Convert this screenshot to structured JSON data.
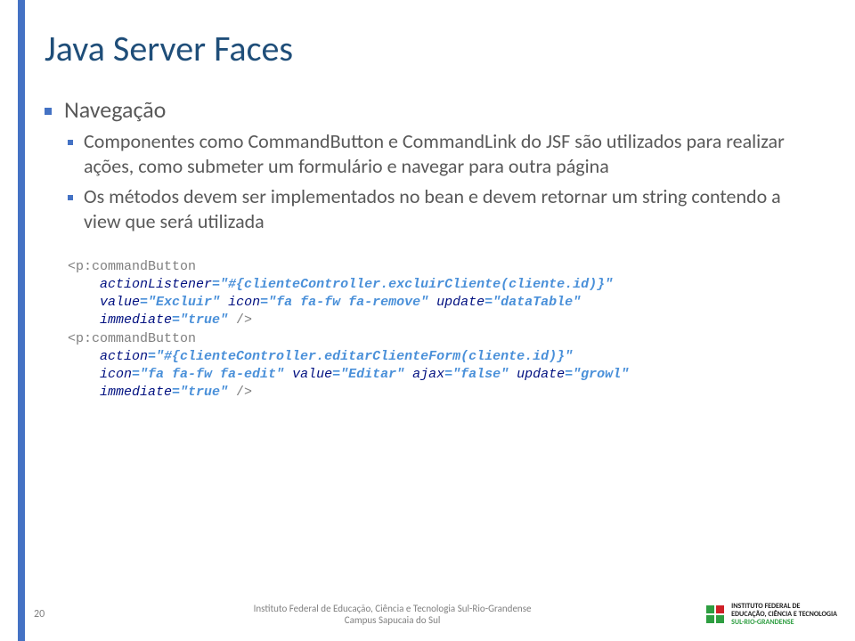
{
  "title": "Java Server Faces",
  "bullets": {
    "l1": "Navegação",
    "l2a": "Componentes como CommandButton e CommandLink do JSF são utilizados para realizar ações, como submeter um formulário e navegar para outra página",
    "l2b": "Os métodos devem ser implementados no bean e devem retornar um string contendo a view que será utilizada"
  },
  "code": {
    "line1a": "<p:commandButton",
    "line2_attr": "actionListener",
    "line2_val": "=\"#{clienteController.excluirCliente(cliente.id)}\"",
    "line3_a1": "value",
    "line3_v1": "=\"Excluir\" ",
    "line3_a2": "icon",
    "line3_v2": "=\"fa fa-fw fa-remove\" ",
    "line3_a3": "update",
    "line3_v3": "=\"dataTable\"",
    "line4_a1": "immediate",
    "line4_v1": "=\"true\" ",
    "line4_close": "/>",
    "line5a": "<p:commandButton",
    "line6_attr": "action",
    "line6_val": "=\"#{clienteController.editarClienteForm(cliente.id)}\"",
    "line7_a1": "icon",
    "line7_v1": "=\"fa fa-fw fa-edit\" ",
    "line7_a2": "value",
    "line7_v2": "=\"Editar\" ",
    "line7_a3": "ajax",
    "line7_v3": "=\"false\" ",
    "line7_a4": "update",
    "line7_v4": "=\"growl\"",
    "line8_a1": "immediate",
    "line8_v1": "=\"true\" ",
    "line8_close": "/>"
  },
  "footer": {
    "slide": "20",
    "line1": "Instituto Federal de Educação, Ciência e Tecnologia Sul-Rio-Grandense",
    "line2": "Campus Sapucaia do Sul",
    "logo_line1": "INSTITUTO FEDERAL DE",
    "logo_line2": "EDUCAÇÃO, CIÊNCIA E TECNOLOGIA",
    "logo_line3": "SUL-RIO-GRANDENSE"
  }
}
